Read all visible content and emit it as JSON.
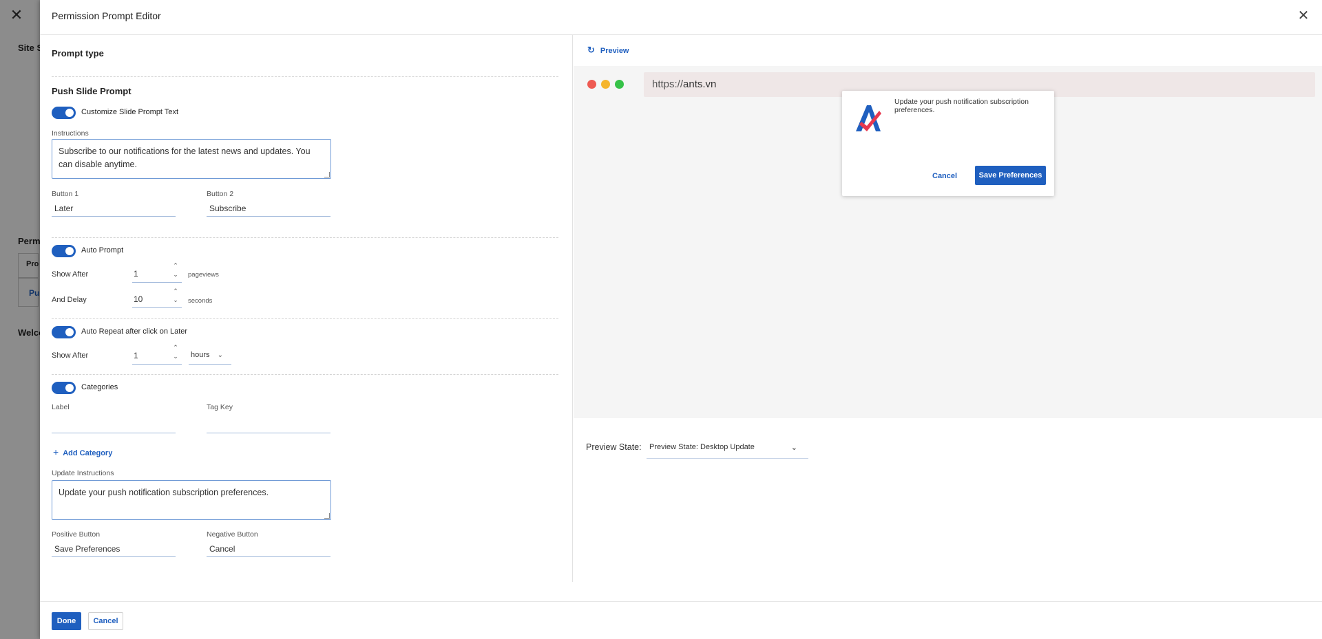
{
  "background": {
    "close_glyph": "✕",
    "site_label": "Site S",
    "perm_label": "Permi",
    "pro_label": "Pro",
    "pu_label": "Pu",
    "welcome_label": "Welco"
  },
  "drawer": {
    "title": "Permission Prompt Editor",
    "close_glyph": "✕"
  },
  "prompt_type": {
    "title": "Prompt type"
  },
  "push_slide": {
    "title": "Push Slide Prompt",
    "customize_label": "Customize Slide Prompt Text",
    "instructions_label": "Instructions",
    "instructions_value": "Subscribe to our notifications for the latest news and updates. You can disable anytime.",
    "button1_label": "Button 1",
    "button1_value": "Later",
    "button2_label": "Button 2",
    "button2_value": "Subscribe"
  },
  "auto_prompt": {
    "label": "Auto Prompt",
    "show_after_label": "Show After",
    "show_after_value": "1",
    "show_after_unit": "pageviews",
    "delay_label": "And Delay",
    "delay_value": "10",
    "delay_unit": "seconds"
  },
  "auto_repeat": {
    "label": "Auto Repeat after click on Later",
    "show_after_label": "Show After",
    "show_after_value": "1",
    "unit_selected": "hours"
  },
  "categories": {
    "label": "Categories",
    "label_field": "Label",
    "tag_key_field": "Tag Key",
    "add_category": "Add Category",
    "update_instructions_label": "Update Instructions",
    "update_instructions_value": "Update your push notification subscription preferences.",
    "positive_label": "Positive Button",
    "positive_value": "Save Preferences",
    "negative_label": "Negative Button",
    "negative_value": "Cancel"
  },
  "footer": {
    "done": "Done",
    "cancel": "Cancel"
  },
  "preview": {
    "link": "Preview",
    "url_scheme": "https://",
    "url_host": "ants.vn",
    "prompt_text": "Update your push notification subscription preferences.",
    "prompt_cancel": "Cancel",
    "prompt_save": "Save Preferences",
    "state_label": "Preview State:",
    "state_value": "Preview State: Desktop Update"
  },
  "colors": {
    "accent": "#1f5fbf",
    "dot_red": "#ee5a52",
    "dot_yellow": "#f5b52d",
    "dot_green": "#36c248"
  }
}
